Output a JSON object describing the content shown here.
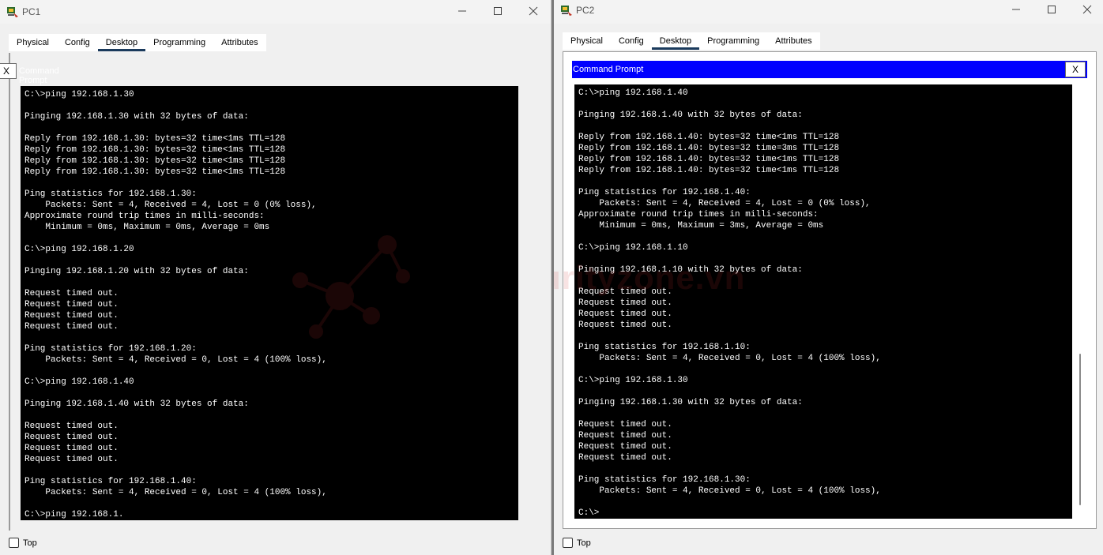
{
  "tabs": [
    "Physical",
    "Config",
    "Desktop",
    "Programming",
    "Attributes"
  ],
  "active_tab": "Desktop",
  "watermark": "securityzone.vn",
  "windows": [
    {
      "id": "left",
      "title": "PC1",
      "command_prompt_title": "Command Prompt",
      "close_label": "X",
      "top_label": "Top",
      "console_lines": [
        "C:\\>ping 192.168.1.30",
        "",
        "Pinging 192.168.1.30 with 32 bytes of data:",
        "",
        "Reply from 192.168.1.30: bytes=32 time<1ms TTL=128",
        "Reply from 192.168.1.30: bytes=32 time<1ms TTL=128",
        "Reply from 192.168.1.30: bytes=32 time<1ms TTL=128",
        "Reply from 192.168.1.30: bytes=32 time<1ms TTL=128",
        "",
        "Ping statistics for 192.168.1.30:",
        "    Packets: Sent = 4, Received = 4, Lost = 0 (0% loss),",
        "Approximate round trip times in milli-seconds:",
        "    Minimum = 0ms, Maximum = 0ms, Average = 0ms",
        "",
        "C:\\>ping 192.168.1.20",
        "",
        "Pinging 192.168.1.20 with 32 bytes of data:",
        "",
        "Request timed out.",
        "Request timed out.",
        "Request timed out.",
        "Request timed out.",
        "",
        "Ping statistics for 192.168.1.20:",
        "    Packets: Sent = 4, Received = 0, Lost = 4 (100% loss),",
        "",
        "C:\\>ping 192.168.1.40",
        "",
        "Pinging 192.168.1.40 with 32 bytes of data:",
        "",
        "Request timed out.",
        "Request timed out.",
        "Request timed out.",
        "Request timed out.",
        "",
        "Ping statistics for 192.168.1.40:",
        "    Packets: Sent = 4, Received = 0, Lost = 4 (100% loss),",
        "",
        "C:\\>ping 192.168.1."
      ]
    },
    {
      "id": "right",
      "title": "PC2",
      "command_prompt_title": "Command Prompt",
      "close_label": "X",
      "top_label": "Top",
      "console_lines": [
        "C:\\>ping 192.168.1.40",
        "",
        "Pinging 192.168.1.40 with 32 bytes of data:",
        "",
        "Reply from 192.168.1.40: bytes=32 time<1ms TTL=128",
        "Reply from 192.168.1.40: bytes=32 time=3ms TTL=128",
        "Reply from 192.168.1.40: bytes=32 time<1ms TTL=128",
        "Reply from 192.168.1.40: bytes=32 time<1ms TTL=128",
        "",
        "Ping statistics for 192.168.1.40:",
        "    Packets: Sent = 4, Received = 4, Lost = 0 (0% loss),",
        "Approximate round trip times in milli-seconds:",
        "    Minimum = 0ms, Maximum = 3ms, Average = 0ms",
        "",
        "C:\\>ping 192.168.1.10",
        "",
        "Pinging 192.168.1.10 with 32 bytes of data:",
        "",
        "Request timed out.",
        "Request timed out.",
        "Request timed out.",
        "Request timed out.",
        "",
        "Ping statistics for 192.168.1.10:",
        "    Packets: Sent = 4, Received = 0, Lost = 4 (100% loss),",
        "",
        "C:\\>ping 192.168.1.30",
        "",
        "Pinging 192.168.1.30 with 32 bytes of data:",
        "",
        "Request timed out.",
        "Request timed out.",
        "Request timed out.",
        "Request timed out.",
        "",
        "Ping statistics for 192.168.1.30:",
        "    Packets: Sent = 4, Received = 0, Lost = 4 (100% loss),",
        "",
        "C:\\>"
      ]
    }
  ]
}
